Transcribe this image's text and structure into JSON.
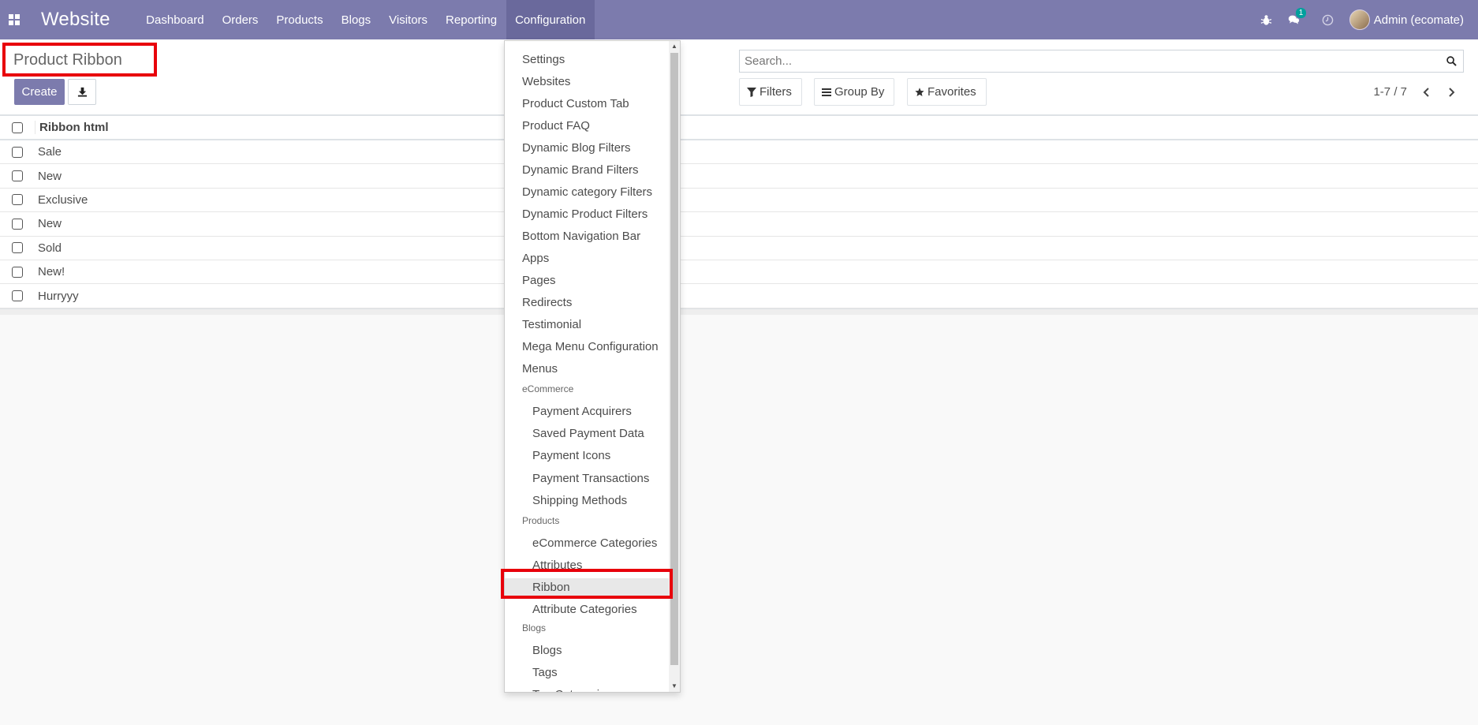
{
  "navbar": {
    "brand": "Website",
    "menu": [
      "Dashboard",
      "Orders",
      "Products",
      "Blogs",
      "Visitors",
      "Reporting",
      "Configuration"
    ],
    "active_menu": "Configuration",
    "message_count": "1",
    "user_name": "Admin (ecomate)"
  },
  "control_panel": {
    "title": "Product Ribbon",
    "create_label": "Create",
    "search_placeholder": "Search...",
    "filters_label": "Filters",
    "group_by_label": "Group By",
    "favorites_label": "Favorites",
    "pager": "1-7 / 7"
  },
  "list": {
    "column": "Ribbon html",
    "rows": [
      "Sale",
      "New",
      "Exclusive",
      "New",
      "Sold",
      "New!",
      "Hurryyy"
    ]
  },
  "dropdown": {
    "items": [
      {
        "label": "Settings",
        "type": "item"
      },
      {
        "label": "Websites",
        "type": "item"
      },
      {
        "label": "Product Custom Tab",
        "type": "item"
      },
      {
        "label": "Product FAQ",
        "type": "item"
      },
      {
        "label": "Dynamic Blog Filters",
        "type": "item"
      },
      {
        "label": "Dynamic Brand Filters",
        "type": "item"
      },
      {
        "label": "Dynamic category Filters",
        "type": "item"
      },
      {
        "label": "Dynamic Product Filters",
        "type": "item"
      },
      {
        "label": "Bottom Navigation Bar",
        "type": "item"
      },
      {
        "label": "Apps",
        "type": "item"
      },
      {
        "label": "Pages",
        "type": "item"
      },
      {
        "label": "Redirects",
        "type": "item"
      },
      {
        "label": "Testimonial",
        "type": "item"
      },
      {
        "label": "Mega Menu Configuration",
        "type": "item"
      },
      {
        "label": "Menus",
        "type": "item"
      },
      {
        "label": "eCommerce",
        "type": "header"
      },
      {
        "label": "Payment Acquirers",
        "type": "sub"
      },
      {
        "label": "Saved Payment Data",
        "type": "sub"
      },
      {
        "label": "Payment Icons",
        "type": "sub"
      },
      {
        "label": "Payment Transactions",
        "type": "sub"
      },
      {
        "label": "Shipping Methods",
        "type": "sub"
      },
      {
        "label": "Products",
        "type": "header"
      },
      {
        "label": "eCommerce Categories",
        "type": "sub"
      },
      {
        "label": "Attributes",
        "type": "sub"
      },
      {
        "label": "Ribbon",
        "type": "sub",
        "active": true
      },
      {
        "label": "Attribute Categories",
        "type": "sub"
      },
      {
        "label": "Blogs",
        "type": "header"
      },
      {
        "label": "Blogs",
        "type": "sub"
      },
      {
        "label": "Tags",
        "type": "sub"
      },
      {
        "label": "Tag Categories",
        "type": "sub"
      }
    ]
  },
  "colors": {
    "navbar": "#7c7bad",
    "highlight": "#e8000b"
  }
}
